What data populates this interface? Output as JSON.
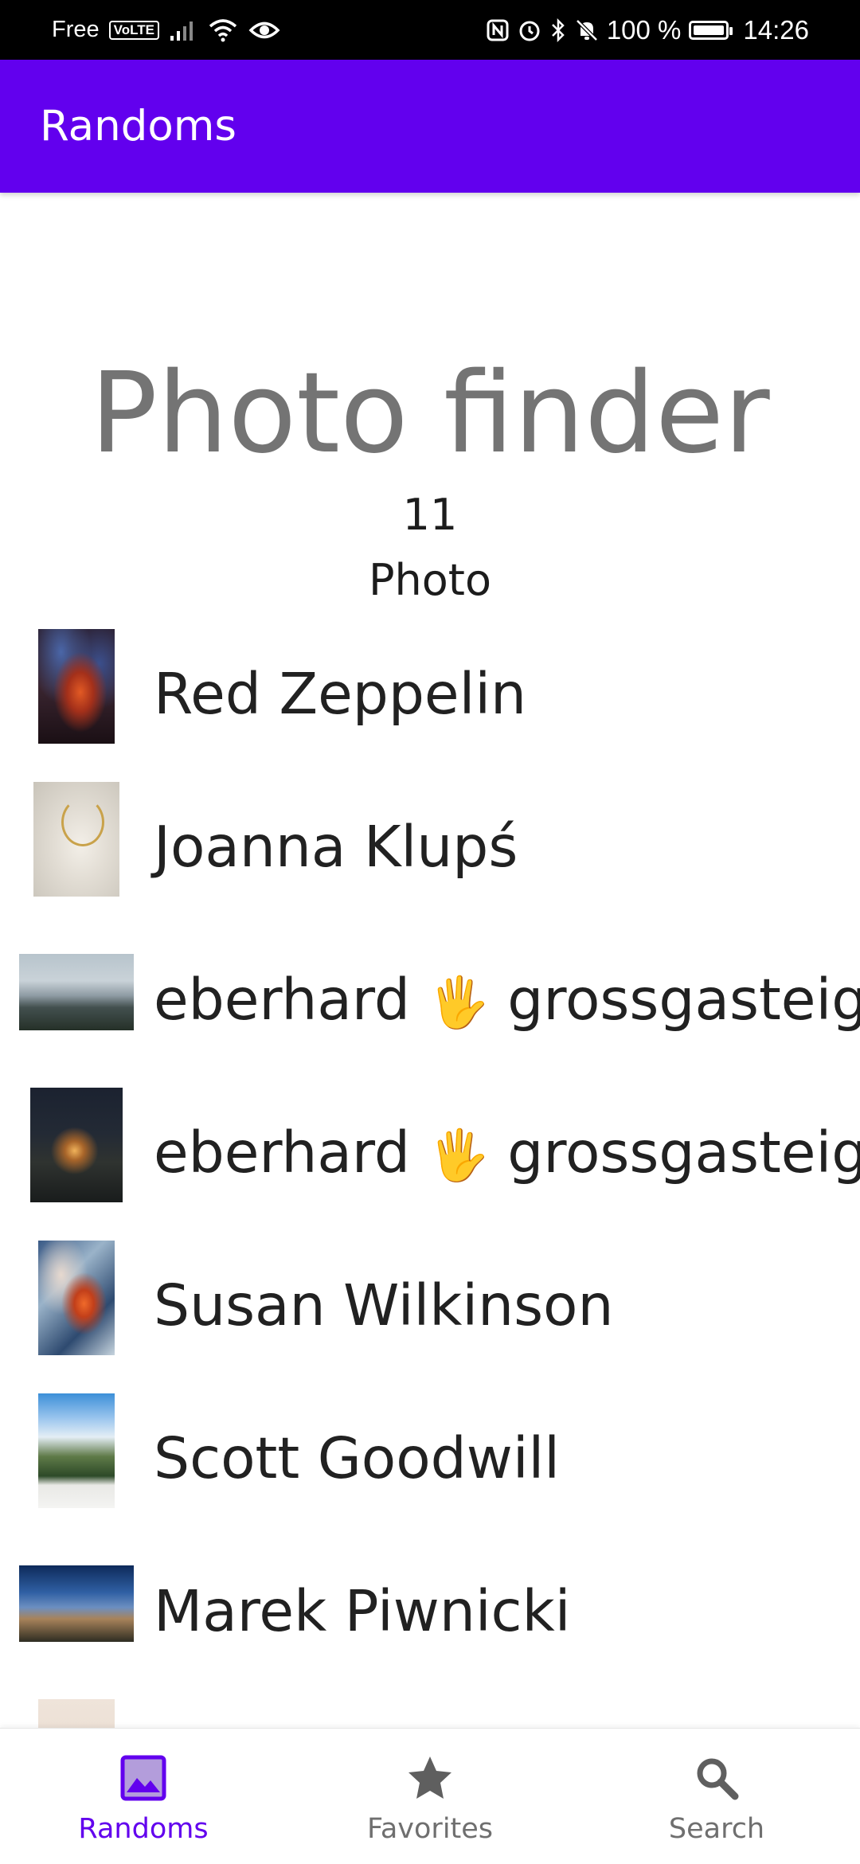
{
  "status_bar": {
    "carrier": "Free",
    "volte": "VoLTE",
    "battery": "100 %",
    "time": "14:26"
  },
  "app_bar": {
    "title": "Randoms"
  },
  "header": {
    "title": "Photo finder",
    "count": "11",
    "count_label": "Photo"
  },
  "photos": [
    {
      "author": "Red Zeppelin",
      "thumb": "abstract-red-blue"
    },
    {
      "author": "Joanna Klupś",
      "thumb": "necklace-on-cloth"
    },
    {
      "author": "eberhard",
      "emoji": "🖐",
      "author_suffix": "grossgasteige",
      "thumb": "snowy-mountains"
    },
    {
      "author": "eberhard",
      "emoji": "🖐",
      "author_suffix": "grossgasteige",
      "thumb": "chapel-at-night"
    },
    {
      "author": "Susan Wilkinson",
      "thumb": "swirl-paint"
    },
    {
      "author": "Scott Goodwill",
      "thumb": "sled-dogs-mountains"
    },
    {
      "author": "Marek Piwnicki",
      "thumb": "night-sky-mountain"
    },
    {
      "author": "",
      "thumb": "flowers"
    }
  ],
  "bottom_nav": {
    "items": [
      {
        "label": "Randoms",
        "icon": "image-icon",
        "active": true
      },
      {
        "label": "Favorites",
        "icon": "star-icon",
        "active": false
      },
      {
        "label": "Search",
        "icon": "search-icon",
        "active": false
      }
    ]
  },
  "colors": {
    "primary": "#6200ee",
    "title_gray": "#747474",
    "text": "#212121",
    "inactive": "#6f6f6f"
  }
}
